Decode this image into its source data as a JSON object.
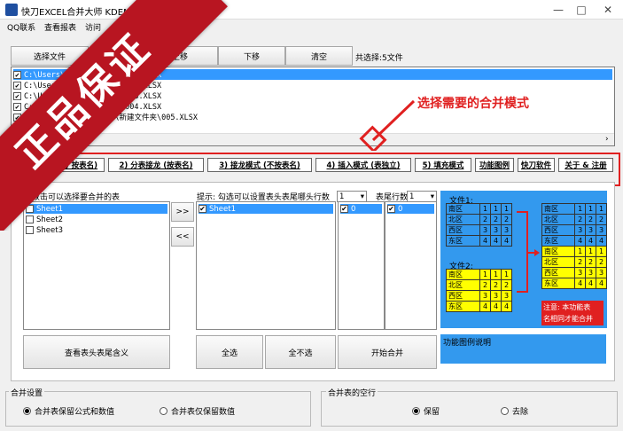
{
  "window": {
    "title": "快刀EXCEL合并大师 KDEMN",
    "controls": [
      "—",
      "□",
      "✕"
    ]
  },
  "menu": {
    "items": [
      "QQ联系",
      "查看报表",
      "访问"
    ]
  },
  "toolbar": {
    "select_files": "选择文件",
    "move_up": "上移",
    "move_down": "下移",
    "clear": "清空",
    "count_text": "共选择:5文件"
  },
  "files": [
    {
      "path": "C:\\Users\\...\\新建文件夹\\001.XLSX",
      "checked": true,
      "selected": true
    },
    {
      "path": "C:\\Users\\...\\新建文件夹\\002.XLSX",
      "checked": true,
      "selected": false
    },
    {
      "path": "C:\\Users\\...\\新建文件夹\\003.XLSX",
      "checked": true,
      "selected": false
    },
    {
      "path": "C:\\Users\\...\\新建文件夹\\004.XLSX",
      "checked": true,
      "selected": false
    },
    {
      "path": "C:\\Users\\...\\Desktop\\新建文件夹\\005.XLSX",
      "checked": true,
      "selected": false
    }
  ],
  "annotation": "选择需要的合并模式",
  "banner": "正品保证",
  "tabs": [
    "1) 按表名)",
    "2) 分表接龙 (按表名)",
    "3) 接龙模式 (不按表名)",
    "4) 插入模式 (表独立)",
    "5) 填充模式",
    "功能图例",
    "快刀软件",
    "关于 & 注册"
  ],
  "left_panel": {
    "hint": "双击可以选择要合并的表",
    "sheets": [
      {
        "name": "Sheet1",
        "checked": false,
        "selected": true
      },
      {
        "name": "Sheet2",
        "checked": false,
        "selected": false
      },
      {
        "name": "Sheet3",
        "checked": false,
        "selected": false
      }
    ],
    "add_btn": ">>",
    "remove_btn": "<<",
    "view_btn": "查看表头表尾含义"
  },
  "mid_panel": {
    "hint": "提示: 勾选可以设置表头表尾哪头行数",
    "header_rows_value": "1",
    "footer_label": "表尾行数",
    "footer_rows_value": "1",
    "selected_sheets": [
      {
        "name": "Sheet1",
        "checked": true
      }
    ],
    "header_values": [
      {
        "value": "0",
        "checked": true
      }
    ],
    "footer_values": [
      {
        "value": "0",
        "checked": true
      }
    ],
    "select_all": "全选",
    "select_none": "全不选",
    "start": "开始合并"
  },
  "diagram": {
    "file1_label": "文件1:",
    "file2_label": "文件2:",
    "file1_rows": [
      [
        "南区",
        "1",
        "1",
        "1"
      ],
      [
        "北区",
        "2",
        "2",
        "2"
      ],
      [
        "西区",
        "3",
        "3",
        "3"
      ],
      [
        "东区",
        "4",
        "4",
        "4"
      ]
    ],
    "file2_rows": [
      [
        "南区",
        "1",
        "1",
        "1"
      ],
      [
        "北区",
        "2",
        "2",
        "2"
      ],
      [
        "西区",
        "3",
        "3",
        "3"
      ],
      [
        "东区",
        "4",
        "4",
        "4"
      ]
    ],
    "note_line1": "注意: 本功能表",
    "note_line2": "名相同才能合并"
  },
  "description_label": "功能图例说明",
  "merge_settings": {
    "title": "合并设置",
    "opt1": "合并表保留公式和数值",
    "opt2": "合并表仅保留数值",
    "selected": "opt1"
  },
  "empty_rows": {
    "title": "合并表的空行",
    "opt1": "保留",
    "opt2": "去除",
    "selected": "opt1"
  },
  "colors": {
    "selection": "#3399ff",
    "diagram_bg": "#3399ee",
    "table_blue": "#3399ee",
    "table_yellow": "#ffff00",
    "banner": "#b81521",
    "annotation": "#e02020"
  }
}
